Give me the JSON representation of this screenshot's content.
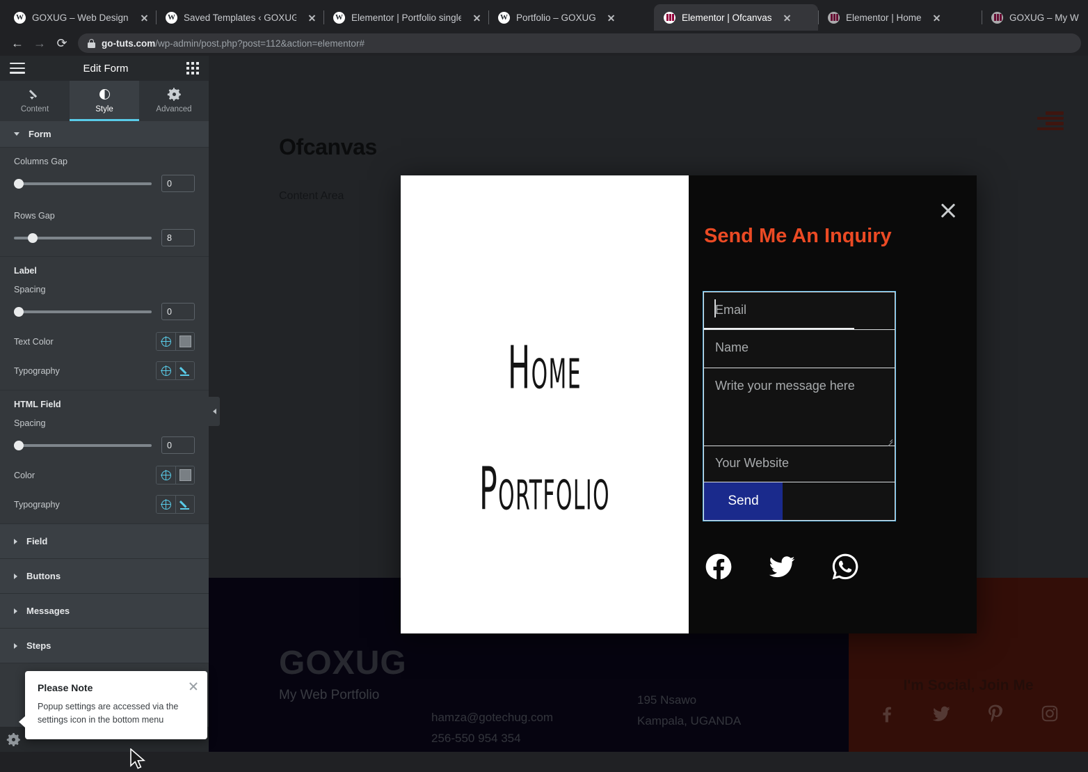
{
  "browser": {
    "tabs": [
      {
        "title": "GOXUG – Web Design Portfolio",
        "favicon": "wordpress-icon",
        "active": false
      },
      {
        "title": "Saved Templates ‹ GOXUG — \u0000",
        "favicon": "wordpress-icon",
        "active": false
      },
      {
        "title": "Elementor | Portfolio single",
        "favicon": "wordpress-icon",
        "active": false
      },
      {
        "title": "Portfolio – GOXUG",
        "favicon": "wordpress-icon",
        "active": false
      },
      {
        "title": "Elementor | Ofcanvas",
        "favicon": "elementor-icon",
        "active": true
      },
      {
        "title": "Elementor | Home",
        "favicon": "elementor-icon",
        "active": false
      },
      {
        "title": "GOXUG – My W",
        "favicon": "elementor-icon",
        "active": false
      }
    ],
    "nav": {
      "back_icon": "back-arrow-icon",
      "forward_icon": "forward-arrow-icon",
      "reload_icon": "reload-icon"
    },
    "address": {
      "lock_icon": "lock-icon",
      "domain": "go-tuts.com",
      "path": "/wp-admin/post.php?post=112&action=elementor#"
    }
  },
  "panel": {
    "header": {
      "menu_icon": "hamburger-menu-icon",
      "title": "Edit Form",
      "apps_icon": "widgets-grid-icon"
    },
    "tabs": [
      {
        "label": "Content",
        "icon": "pencil-icon",
        "active": false
      },
      {
        "label": "Style",
        "icon": "contrast-icon",
        "active": true
      },
      {
        "label": "Advanced",
        "icon": "gear-icon",
        "active": false
      }
    ],
    "accent_color": "#59cbe8",
    "sections": {
      "form": {
        "title": "Form",
        "columns_gap": {
          "label": "Columns Gap",
          "value": "0",
          "slider_pct": 0
        },
        "rows_gap": {
          "label": "Rows Gap",
          "value": "8",
          "slider_pct": 13
        }
      },
      "label": {
        "title": "Label",
        "spacing": {
          "label": "Spacing",
          "value": "0",
          "slider_pct": 0
        },
        "text_color": {
          "label": "Text Color",
          "globe_icon": "responsive-globe-icon",
          "swatch_color": "#797f84"
        },
        "typography": {
          "label": "Typography",
          "globe_icon": "responsive-globe-icon",
          "edit_icon": "pencil-edit-icon"
        }
      },
      "html_field": {
        "title": "HTML Field",
        "spacing": {
          "label": "Spacing",
          "value": "0",
          "slider_pct": 0
        },
        "color": {
          "label": "Color",
          "globe_icon": "responsive-globe-icon",
          "swatch_color": "#797f84"
        },
        "typography": {
          "label": "Typography",
          "globe_icon": "responsive-globe-icon",
          "edit_icon": "pencil-edit-icon"
        }
      },
      "collapsed": [
        {
          "label": "Field"
        },
        {
          "label": "Buttons"
        },
        {
          "label": "Messages"
        },
        {
          "label": "Steps"
        }
      ]
    },
    "footer": {
      "settings_icon": "gear-icon"
    },
    "collapse_icon": "chevron-left-icon"
  },
  "tooltip": {
    "title": "Please Note",
    "body": "Popup settings are accessed via the settings icon in the bottom menu",
    "close_icon": "close-icon"
  },
  "preview": {
    "page_title": "Ofcanvas",
    "content_area": "Content Area",
    "nav_toggle_icon": "hamburger-menu-icon",
    "footer": {
      "brand": "GOXUG",
      "brand_sub": "My Web Portfolio",
      "email": "hamza@gotechug.com",
      "phone": "256-550 954 354",
      "address_line1": "195 Nsawo",
      "address_line2": "Kampala, UGANDA",
      "social_title": "I'm Social, Join Me",
      "social_icons": [
        "facebook-icon",
        "twitter-icon",
        "pinterest-icon",
        "instagram-icon"
      ],
      "dark_bg": "#0a0718",
      "red_bg": "#4a150c"
    }
  },
  "popup": {
    "close_icon": "close-icon",
    "menu": {
      "items": [
        "Home",
        "Portfolio"
      ]
    },
    "form": {
      "heading": "Send Me An Inquiry",
      "fields": [
        {
          "name": "email",
          "placeholder": "Email"
        },
        {
          "name": "name",
          "placeholder": "Name"
        },
        {
          "name": "message",
          "placeholder": "Write your message here"
        },
        {
          "name": "website",
          "placeholder": "Your Website"
        }
      ],
      "submit_label": "Send",
      "submit_color": "#1a2a8c",
      "selection_color": "#5bb8e8",
      "heading_color": "#eb4a24"
    },
    "social_icons": [
      "facebook-icon",
      "twitter-icon",
      "whatsapp-icon"
    ]
  }
}
